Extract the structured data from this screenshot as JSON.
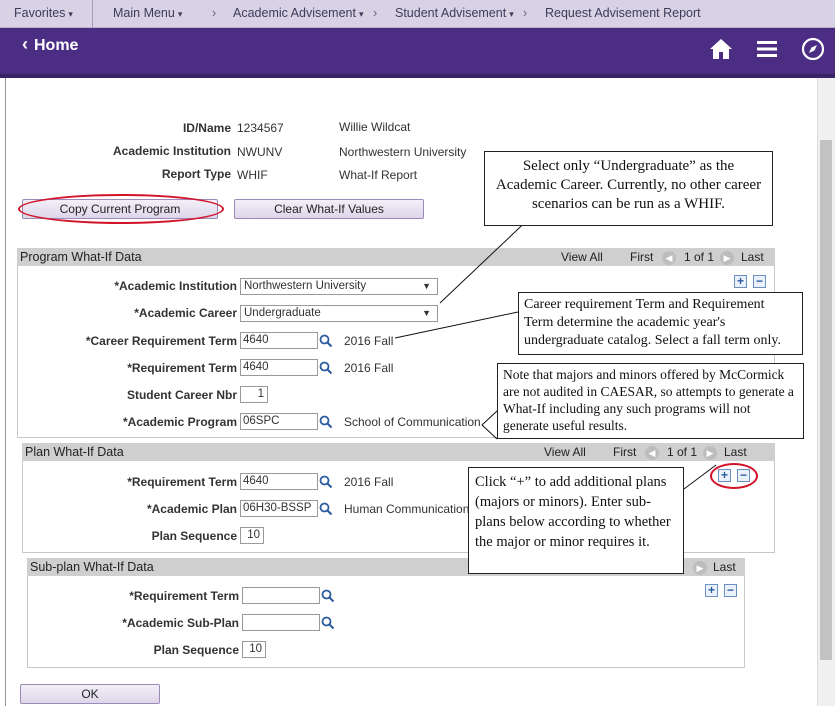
{
  "nav": {
    "favorites": "Favorites",
    "main_menu": "Main Menu",
    "academic_advisement": "Academic Advisement",
    "student_advisement": "Student Advisement",
    "request_report": "Request Advisement Report",
    "crumb_sep": "›",
    "caret": "▾"
  },
  "titlebar": {
    "home": "Home",
    "back_glyph": "‹"
  },
  "info": {
    "id_label": "ID/Name",
    "id_value": "1234567",
    "name_value": "Willie Wildcat",
    "inst_label": "Academic Institution",
    "inst_code": "NWUNV",
    "inst_name": "Northwestern University",
    "rtype_label": "Report Type",
    "rtype_code": "WHIF",
    "rtype_name": "What-If Report"
  },
  "buttons": {
    "copy": "Copy Current Program",
    "clear": "Clear What-If Values",
    "ok": "OK"
  },
  "program_section": {
    "title": "Program What-If Data",
    "view_all": "View All",
    "first": "First",
    "count": "1 of 1",
    "last": "Last",
    "institution_label": "*Academic Institution",
    "institution_value": "Northwestern University",
    "career_label": "*Academic Career",
    "career_value": "Undergraduate",
    "career_term_label": "*Career Requirement Term",
    "career_term_value": "4640",
    "career_term_desc": "2016 Fall",
    "req_term_label": "*Requirement Term",
    "req_term_value": "4640",
    "req_term_desc": "2016 Fall",
    "career_nbr_label": "Student Career Nbr",
    "career_nbr_value": "1",
    "program_label": "*Academic Program",
    "program_value": "06SPC",
    "program_desc": "School of Communication"
  },
  "plan_section": {
    "title": "Plan What-If Data",
    "view_all": "View All",
    "first": "First",
    "count": "1 of 1",
    "last": "Last",
    "req_term_label": "*Requirement Term",
    "req_term_value": "4640",
    "req_term_desc": "2016 Fall",
    "plan_label": "*Academic Plan",
    "plan_value": "06H30-BSSP",
    "plan_desc": "Human Communication",
    "seq_label": "Plan Sequence",
    "seq_value": "10"
  },
  "subplan_section": {
    "title": "Sub-plan What-If Data",
    "last": "Last",
    "req_term_label": "*Requirement Term",
    "subplan_label": "*Academic Sub-Plan",
    "seq_label": "Plan Sequence",
    "seq_value": "10"
  },
  "callouts": {
    "career": "Select only “Undergraduate” as the Academic Career. Currently, no other career scenarios can be run as a WHIF.",
    "term": "Career requirement Term and Requirement Term determine the academic year's undergraduate catalog. Select a fall term only.",
    "mccormick": "Note that majors and minors offered by McCormick are not audited in CAESAR, so attempts to generate a What-If including any such programs will not generate useful results.",
    "plus": "Click “+” to add additional plans (majors or minors). Enter sub-plans below according to whether the major or minor requires it."
  },
  "colors": {
    "brand": "#4b2e83",
    "nav_bg": "#d8d2e4",
    "highlight": "#d2142a"
  }
}
